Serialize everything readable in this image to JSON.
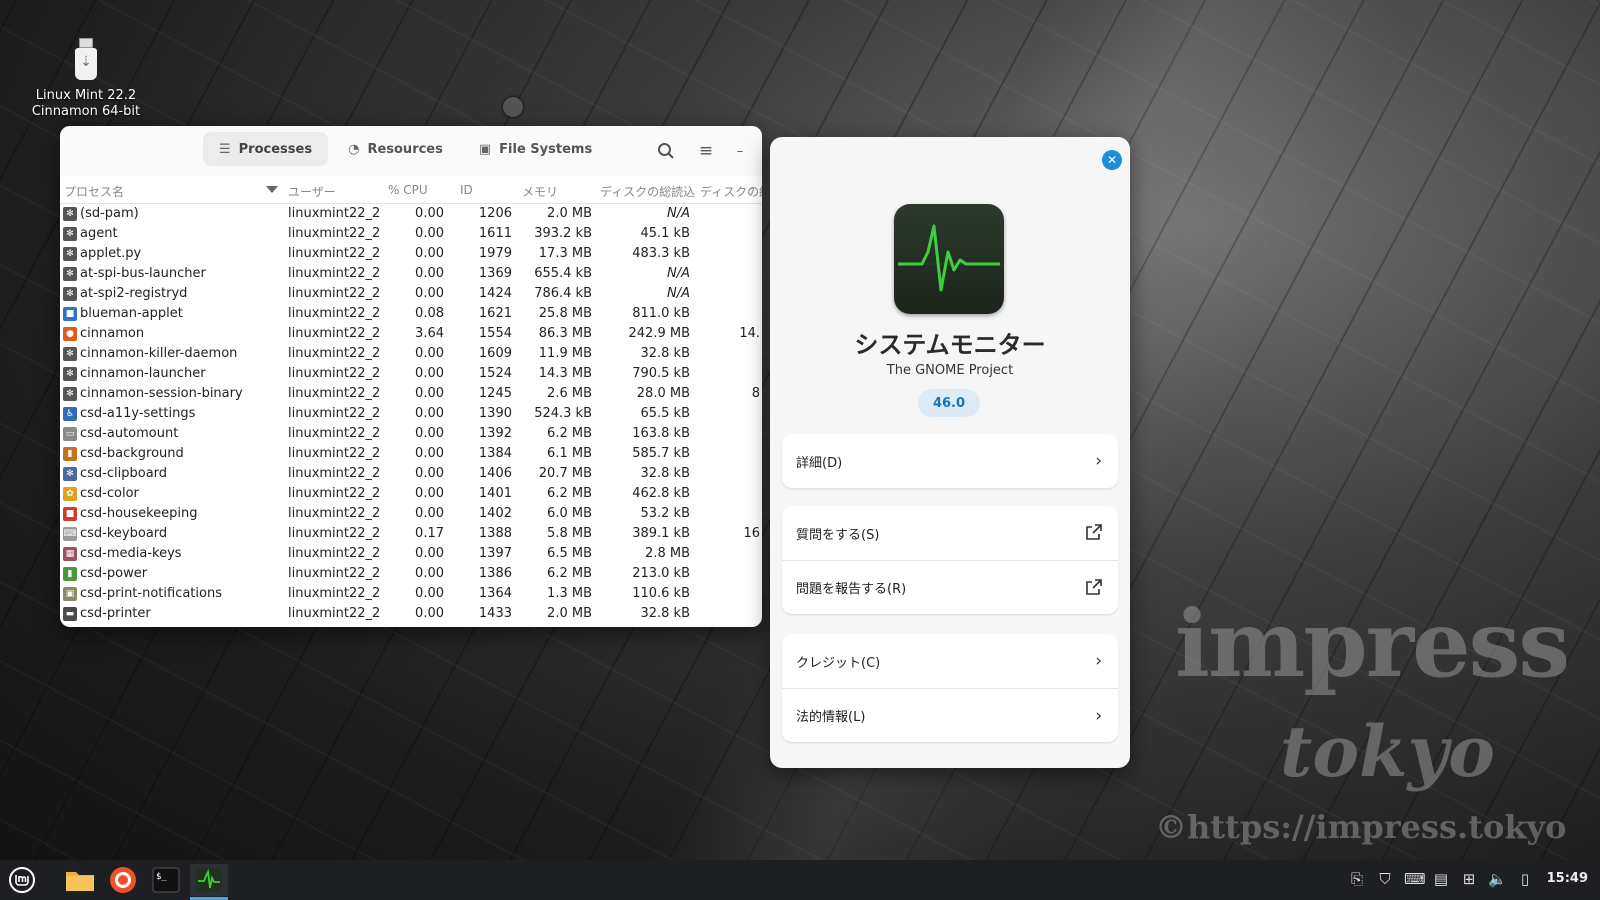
{
  "desktop": {
    "icon_label_line1": "Linux Mint 22.2",
    "icon_label_line2": "Cinnamon 64-bit",
    "watermark1": "impress",
    "watermark2": "tokyo",
    "watermark3": "©https://impress.tokyo"
  },
  "sysmon": {
    "tabs": [
      {
        "label": "Processes",
        "icon": "list-icon"
      },
      {
        "label": "Resources",
        "icon": "gauge-icon"
      },
      {
        "label": "File Systems",
        "icon": "disk-icon"
      }
    ],
    "columns": {
      "name": "プロセス名",
      "user": "ユーザー",
      "cpu": "% CPU",
      "id": "ID",
      "mem": "メモリ",
      "disk_read": "ディスクの総読込",
      "disk_write": "ディスクの総"
    },
    "rows": [
      {
        "name": "(sd-pam)",
        "user": "linuxmint22_2",
        "cpu": "0.00",
        "id": "1206",
        "mem": "2.0 MB",
        "disk": "N/A",
        "disk2": "",
        "icon": "gear",
        "color": "#555555"
      },
      {
        "name": "agent",
        "user": "linuxmint22_2",
        "cpu": "0.00",
        "id": "1611",
        "mem": "393.2 kB",
        "disk": "45.1 kB",
        "disk2": "",
        "icon": "gear",
        "color": "#555555"
      },
      {
        "name": "applet.py",
        "user": "linuxmint22_2",
        "cpu": "0.00",
        "id": "1979",
        "mem": "17.3 MB",
        "disk": "483.3 kB",
        "disk2": "",
        "icon": "gear",
        "color": "#555555"
      },
      {
        "name": "at-spi-bus-launcher",
        "user": "linuxmint22_2",
        "cpu": "0.00",
        "id": "1369",
        "mem": "655.4 kB",
        "disk": "N/A",
        "disk2": "",
        "icon": "gear",
        "color": "#555555"
      },
      {
        "name": "at-spi2-registryd",
        "user": "linuxmint22_2",
        "cpu": "0.00",
        "id": "1424",
        "mem": "786.4 kB",
        "disk": "N/A",
        "disk2": "",
        "icon": "gear",
        "color": "#555555"
      },
      {
        "name": "blueman-applet",
        "user": "linuxmint22_2",
        "cpu": "0.08",
        "id": "1621",
        "mem": "25.8 MB",
        "disk": "811.0 kB",
        "disk2": "",
        "icon": "square",
        "color": "#2f73c8"
      },
      {
        "name": "cinnamon",
        "user": "linuxmint22_2",
        "cpu": "3.64",
        "id": "1554",
        "mem": "86.3 MB",
        "disk": "242.9 MB",
        "disk2": "14.",
        "icon": "circle",
        "color": "#e05a1d"
      },
      {
        "name": "cinnamon-killer-daemon",
        "user": "linuxmint22_2",
        "cpu": "0.00",
        "id": "1609",
        "mem": "11.9 MB",
        "disk": "32.8 kB",
        "disk2": "",
        "icon": "gear",
        "color": "#555555"
      },
      {
        "name": "cinnamon-launcher",
        "user": "linuxmint22_2",
        "cpu": "0.00",
        "id": "1524",
        "mem": "14.3 MB",
        "disk": "790.5 kB",
        "disk2": "",
        "icon": "gear",
        "color": "#555555"
      },
      {
        "name": "cinnamon-session-binary",
        "user": "linuxmint22_2",
        "cpu": "0.00",
        "id": "1245",
        "mem": "2.6 MB",
        "disk": "28.0 MB",
        "disk2": "8",
        "icon": "gear",
        "color": "#555555"
      },
      {
        "name": "csd-a11y-settings",
        "user": "linuxmint22_2",
        "cpu": "0.00",
        "id": "1390",
        "mem": "524.3 kB",
        "disk": "65.5 kB",
        "disk2": "",
        "icon": "person",
        "color": "#2f6db5"
      },
      {
        "name": "csd-automount",
        "user": "linuxmint22_2",
        "cpu": "0.00",
        "id": "1392",
        "mem": "6.2 MB",
        "disk": "163.8 kB",
        "disk2": "",
        "icon": "drive",
        "color": "#8a8a8a"
      },
      {
        "name": "csd-background",
        "user": "linuxmint22_2",
        "cpu": "0.00",
        "id": "1384",
        "mem": "6.1 MB",
        "disk": "585.7 kB",
        "disk2": "",
        "icon": "bars",
        "color": "#c8701e"
      },
      {
        "name": "csd-clipboard",
        "user": "linuxmint22_2",
        "cpu": "0.00",
        "id": "1406",
        "mem": "20.7 MB",
        "disk": "32.8 kB",
        "disk2": "",
        "icon": "gear",
        "color": "#4a6a9a"
      },
      {
        "name": "csd-color",
        "user": "linuxmint22_2",
        "cpu": "0.00",
        "id": "1401",
        "mem": "6.2 MB",
        "disk": "462.8 kB",
        "disk2": "",
        "icon": "flower",
        "color": "#e0a020"
      },
      {
        "name": "csd-housekeeping",
        "user": "linuxmint22_2",
        "cpu": "0.00",
        "id": "1402",
        "mem": "6.0 MB",
        "disk": "53.2 kB",
        "disk2": "",
        "icon": "square",
        "color": "#d23a2a"
      },
      {
        "name": "csd-keyboard",
        "user": "linuxmint22_2",
        "cpu": "0.17",
        "id": "1388",
        "mem": "5.8 MB",
        "disk": "389.1 kB",
        "disk2": "16",
        "icon": "keyboard",
        "color": "#9a9a9a"
      },
      {
        "name": "csd-media-keys",
        "user": "linuxmint22_2",
        "cpu": "0.00",
        "id": "1397",
        "mem": "6.5 MB",
        "disk": "2.8 MB",
        "disk2": "",
        "icon": "keys",
        "color": "#a05060"
      },
      {
        "name": "csd-power",
        "user": "linuxmint22_2",
        "cpu": "0.00",
        "id": "1386",
        "mem": "6.2 MB",
        "disk": "213.0 kB",
        "disk2": "",
        "icon": "battery",
        "color": "#4a9a3a"
      },
      {
        "name": "csd-print-notifications",
        "user": "linuxmint22_2",
        "cpu": "0.00",
        "id": "1364",
        "mem": "1.3 MB",
        "disk": "110.6 kB",
        "disk2": "",
        "icon": "print",
        "color": "#8a8a6a"
      },
      {
        "name": "csd-printer",
        "user": "linuxmint22_2",
        "cpu": "0.00",
        "id": "1433",
        "mem": "2.0 MB",
        "disk": "32.8 kB",
        "disk2": "",
        "icon": "printer",
        "color": "#4a4a4a"
      }
    ]
  },
  "about": {
    "app_name": "システムモニター",
    "developer": "The GNOME Project",
    "version": "46.0",
    "details": "詳細(D)",
    "ask": "質問をする(S)",
    "report": "問題を報告する(R)",
    "credits": "クレジット(C)",
    "legal": "法的情報(L)"
  },
  "taskbar": {
    "clock": "15:49",
    "apps": [
      "files",
      "firefox",
      "terminal",
      "system-monitor"
    ]
  },
  "colors": {
    "accent": "#1c8fd8",
    "pulse_green": "#3ecf3e",
    "taskbar": "#1d1f22"
  }
}
